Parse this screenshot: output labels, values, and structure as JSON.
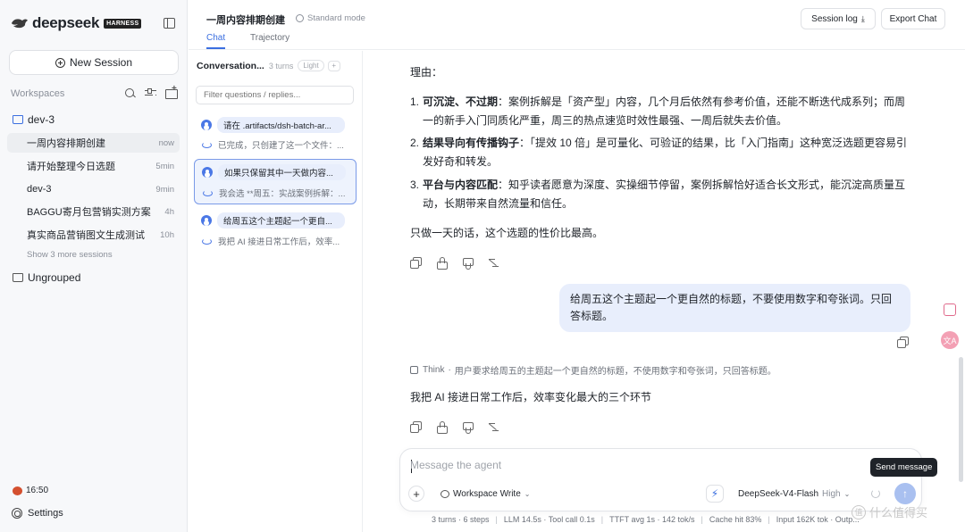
{
  "brand": {
    "name": "deepseek",
    "badge": "HARNESS"
  },
  "sidebar": {
    "new_session": "New Session",
    "workspaces_label": "Workspaces",
    "folders": [
      {
        "name": "dev-3"
      },
      {
        "name": "Ungrouped"
      }
    ],
    "sessions": [
      {
        "label": "一周内容排期创建",
        "time": "now"
      },
      {
        "label": "请开始整理今日选题",
        "time": "5min"
      },
      {
        "label": "dev-3",
        "time": "9min"
      },
      {
        "label": "BAGGU寄月包营销实测方案",
        "time": "4h"
      },
      {
        "label": "真实商品营销图文生成测试",
        "time": "10h"
      }
    ],
    "show_more": "Show 3 more sessions",
    "clock": "16:50",
    "settings": "Settings"
  },
  "header": {
    "title": "一周内容排期创建",
    "mode": "Standard mode",
    "tabs": [
      {
        "label": "Chat"
      },
      {
        "label": "Trajectory"
      }
    ],
    "session_log": "Session log",
    "export_chat": "Export Chat"
  },
  "conversation": {
    "title": "Conversation...",
    "turns": "3 turns",
    "pill": "Light",
    "plus": "+",
    "filter_placeholder": "Filter questions / replies...",
    "items": [
      {
        "q": "请在 .artifacts/dsh-batch-ar...",
        "a": "已完成，只创建了这一个文件：..."
      },
      {
        "q": "如果只保留其中一天做内容...",
        "a": "我会选 **周五：实战案例拆解：..."
      },
      {
        "q": "给周五这个主题起一个更自...",
        "a": "我把 AI 接进日常工作后，效率..."
      }
    ]
  },
  "chat": {
    "reason_label": "理由：",
    "points": [
      {
        "num": "1.",
        "bold": "可沉淀、不过期",
        "text": "：案例拆解是「资产型」内容，几个月后依然有参考价值，还能不断迭代成系列；而周一的新手入门同质化严重，周三的热点速览时效性最强、一周后就失去价值。"
      },
      {
        "num": "2.",
        "bold": "结果导向有传播钩子",
        "text": "：「提效 10 倍」是可量化、可验证的结果，比「入门指南」这种宽泛选题更容易引发好奇和转发。"
      },
      {
        "num": "3.",
        "bold": "平台与内容匹配",
        "text": "：知乎读者愿意为深度、实操细节停留，案例拆解恰好适合长文形式，能沉淀高质量互动，长期带来自然流量和信任。"
      }
    ],
    "conclusion": "只做一天的话，这个选题的性价比最高。",
    "user_message": "给周五这个主题起一个更自然的标题，不要使用数字和夸张词。只回答标题。",
    "think_label": "Think",
    "think_text": "用户要求给周五的主题起一个更自然的标题，不使用数字和夸张词，只回答标题。",
    "reply": "我把 AI 接进日常工作后，效率变化最大的三个环节"
  },
  "composer": {
    "placeholder": "Message the agent",
    "workspace": "Workspace Write",
    "model": "DeepSeek-V4-Flash",
    "level": "High",
    "tooltip": "Send message"
  },
  "stats": {
    "items": [
      "3 turns · 6 steps",
      "LLM 14.5s · Tool call 0.1s",
      "TTFT avg 1s · 142 tok/s",
      "Cache hit 83%",
      "Input 162K tok · Outp..."
    ]
  },
  "watermark": {
    "badge": "值",
    "text": "什么值得买"
  },
  "rail": {
    "avatar": "文A"
  },
  "colors": {
    "accent": "#3b6fe0",
    "user_bubble": "#e8eefc",
    "send_button": "#a9c0f0"
  },
  "icons": [
    "deepseek-whale-icon",
    "sidebar-toggle-icon",
    "search-icon",
    "filter-icon",
    "new-folder-icon",
    "folder-icon",
    "gear-icon",
    "download-icon",
    "copy-icon",
    "thumbs-up-icon",
    "thumbs-down-icon",
    "branch-icon",
    "send-icon",
    "bolt-icon",
    "plus-icon"
  ]
}
